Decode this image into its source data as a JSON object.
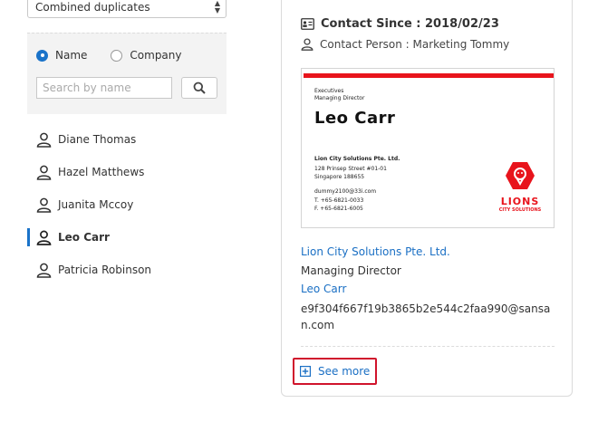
{
  "filter": {
    "dropdown_value": "Combined duplicates",
    "radio_options": [
      {
        "label": "Name",
        "checked": true
      },
      {
        "label": "Company",
        "checked": false
      }
    ],
    "search_placeholder": "Search by name"
  },
  "people": [
    {
      "name": "Diane Thomas",
      "active": false
    },
    {
      "name": "Hazel Matthews",
      "active": false
    },
    {
      "name": "Juanita Mccoy",
      "active": false
    },
    {
      "name": "Leo Carr",
      "active": true
    },
    {
      "name": "Patricia Robinson",
      "active": false
    }
  ],
  "detail": {
    "contact_since": "Contact Since : 2018/02/23",
    "contact_person": "Contact Person : Marketing Tommy",
    "business_card": {
      "dept": "Executives",
      "position": "Managing Director",
      "name": "Leo Carr",
      "company": "Lion City Solutions Pte. Ltd.",
      "address_1": "128 Prinsep Street #01-01",
      "address_2": "Singapore 188655",
      "email": "dummy2100@33i.com",
      "phone": "T. +65-6821-0033",
      "fax": "F. +65-6821-6005",
      "logo_word": "LIONS",
      "logo_sub": "CITY SOLUTIONS"
    },
    "company": "Lion City Solutions Pte. Ltd.",
    "title": "Managing Director",
    "name": "Leo Carr",
    "email": "e9f304f667f19b3865b2e544c2faa990@sansan.com",
    "see_more_label": "See more"
  },
  "colors": {
    "accent": "#1a73c9",
    "link": "#1a6fc4",
    "highlight_border": "#d0142c",
    "brand_red": "#e8141c"
  }
}
